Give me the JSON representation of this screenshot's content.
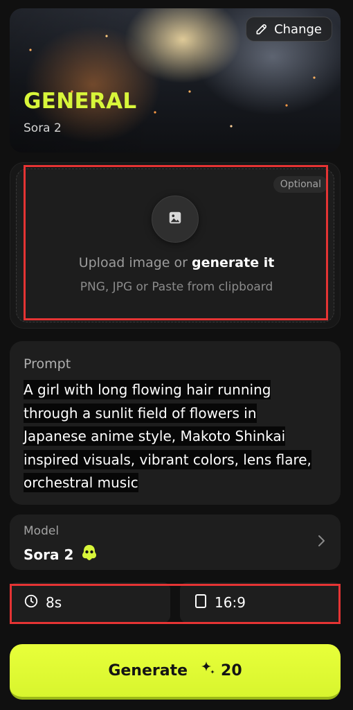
{
  "hero": {
    "title": "GENERAL",
    "subtitle": "Sora 2",
    "change_label": "Change",
    "title_color": "#d8f63a"
  },
  "upload": {
    "badge": "Optional",
    "line1_prefix": "Upload image or ",
    "line1_action": "generate it",
    "line2": "PNG, JPG or Paste from clipboard"
  },
  "prompt": {
    "label": "Prompt",
    "text": "A girl with long flowing hair running through a sunlit field of flowers in Japanese anime style, Makoto Shinkai inspired visuals, vibrant colors, lens flare, orchestral music"
  },
  "model": {
    "label": "Model",
    "value": "Sora 2"
  },
  "settings": {
    "duration": "8s",
    "aspect_ratio": "16:9"
  },
  "generate": {
    "label": "Generate",
    "cost": "20"
  },
  "colors": {
    "accent": "#d8f63a",
    "highlight_border": "#e53434"
  }
}
